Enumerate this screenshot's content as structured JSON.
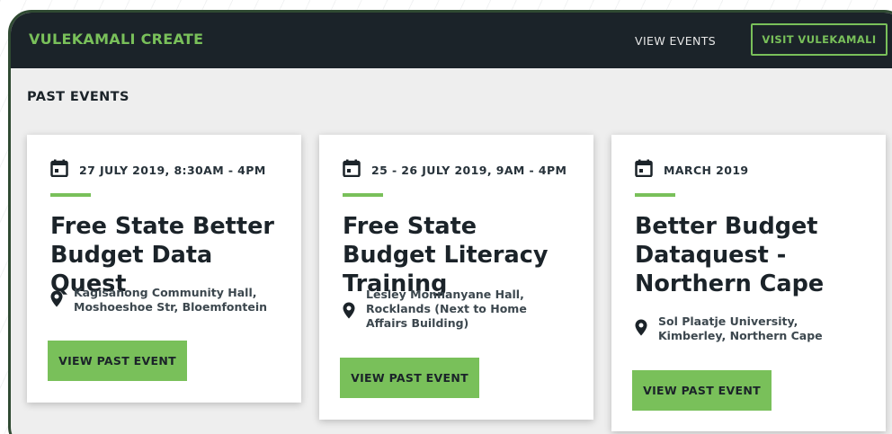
{
  "header": {
    "brand": "VULEKAMALI CREATE",
    "nav_view_events": "VIEW EVENTS",
    "visit_button": "VISIT VULEKAMALI"
  },
  "section": {
    "title": "PAST EVENTS"
  },
  "cards": [
    {
      "date": "27 JULY 2019, 8:30AM - 4PM",
      "title": "Free State Better Budget Data Quest",
      "location": "Kagisanong Community Hall, Moshoeshoe Str, Bloemfontein",
      "button": "VIEW PAST EVENT"
    },
    {
      "date": "25 - 26 JULY 2019, 9AM - 4PM",
      "title": "Free State Budget Literacy Training",
      "location": "Lesley Monnanyane Hall, Rocklands (Next to Home Affairs Building)",
      "button": "VIEW PAST EVENT"
    },
    {
      "date": "MARCH 2019",
      "title": "Better Budget Dataquest - Northern Cape",
      "location": "Sol Plaatje University, Kimberley, Northern Cape",
      "button": "VIEW PAST EVENT"
    }
  ],
  "colors": {
    "accent_green": "#79c05a",
    "header_dark": "#1b2329",
    "page_bg": "#eeeeee",
    "frame_border": "#2f4a32"
  },
  "icons": {
    "date": "calendar-icon",
    "location": "map-pin-icon"
  }
}
